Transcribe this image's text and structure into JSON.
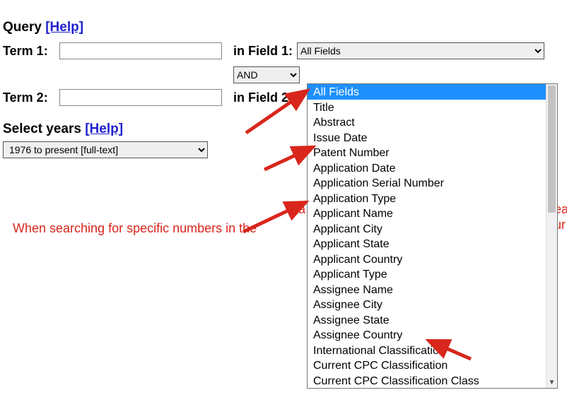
{
  "header": {
    "query_label": "Query",
    "help_label": "[Help]"
  },
  "term1": {
    "label": "Term 1:",
    "value": "",
    "in_field_label": "in Field 1:"
  },
  "term2": {
    "label": "Term 2:",
    "value": "",
    "in_field_label": "in Field 2:"
  },
  "bool_op": {
    "selected": "AND"
  },
  "field1": {
    "selected": "All Fields"
  },
  "years": {
    "label": "Select years",
    "help_label": "[Help]",
    "selected": "1976 to present [full-text]"
  },
  "hints": {
    "h1": "When searching for specific numbers in the",
    "h2": "Pa",
    "h3": "ea",
    "h4": "ur"
  },
  "dropdown": {
    "items": [
      "All Fields",
      "Title",
      "Abstract",
      "Issue Date",
      "Patent Number",
      "Application Date",
      "Application Serial Number",
      "Application Type",
      "Applicant Name",
      "Applicant City",
      "Applicant State",
      "Applicant Country",
      "Applicant Type",
      "Assignee Name",
      "Assignee City",
      "Assignee State",
      "Assignee Country",
      "International Classification",
      "Current CPC Classification",
      "Current CPC Classification Class"
    ],
    "selected_index": 0
  }
}
